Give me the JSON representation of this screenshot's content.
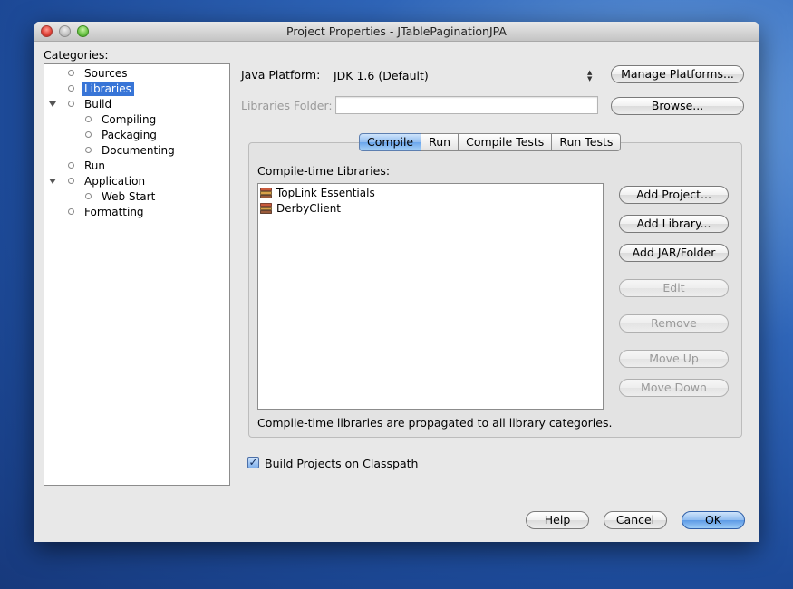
{
  "window": {
    "title": "Project Properties - JTablePaginationJPA"
  },
  "categories": {
    "label": "Categories:",
    "items": [
      {
        "label": "Sources",
        "expandable": false,
        "selected": false
      },
      {
        "label": "Libraries",
        "expandable": false,
        "selected": true
      },
      {
        "label": "Build",
        "expandable": true,
        "selected": false
      },
      {
        "label": "Compiling",
        "expandable": false,
        "selected": false
      },
      {
        "label": "Packaging",
        "expandable": false,
        "selected": false
      },
      {
        "label": "Documenting",
        "expandable": false,
        "selected": false
      },
      {
        "label": "Run",
        "expandable": false,
        "selected": false
      },
      {
        "label": "Application",
        "expandable": true,
        "selected": false
      },
      {
        "label": "Web Start",
        "expandable": false,
        "selected": false
      },
      {
        "label": "Formatting",
        "expandable": false,
        "selected": false
      }
    ]
  },
  "platform": {
    "label": "Java Platform:",
    "value": "JDK 1.6 (Default)",
    "manage_button": "Manage Platforms..."
  },
  "libraries_folder": {
    "label": "Libraries Folder:",
    "value": "",
    "browse_button": "Browse..."
  },
  "tabs": [
    {
      "label": "Compile",
      "active": true
    },
    {
      "label": "Run",
      "active": false
    },
    {
      "label": "Compile Tests",
      "active": false
    },
    {
      "label": "Run Tests",
      "active": false
    }
  ],
  "compile": {
    "list_label": "Compile-time Libraries:",
    "libraries": [
      "TopLink Essentials",
      "DerbyClient"
    ],
    "buttons": {
      "add_project": "Add Project...",
      "add_library": "Add Library...",
      "add_jar": "Add JAR/Folder",
      "edit": "Edit",
      "remove": "Remove",
      "move_up": "Move Up",
      "move_down": "Move Down"
    },
    "note": "Compile-time libraries are propagated to all library categories."
  },
  "build_on_classpath": {
    "label": "Build Projects on Classpath",
    "checked": true
  },
  "footer": {
    "help": "Help",
    "cancel": "Cancel",
    "ok": "OK"
  },
  "colors": {
    "selection": "#3875d7",
    "default_button": "#5d9ae6",
    "desktop": "#2f65b8"
  }
}
